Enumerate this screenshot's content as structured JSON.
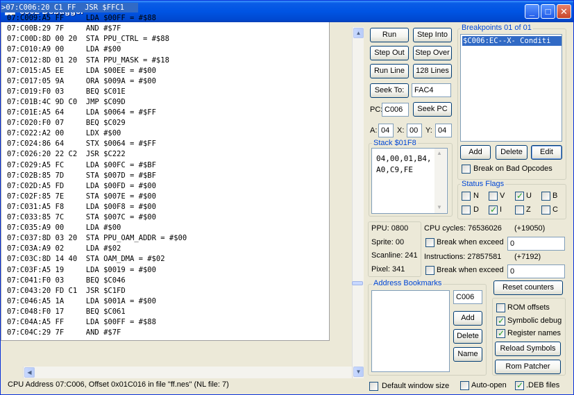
{
  "window": {
    "title": "6502 Debugger",
    "minimize": "_",
    "maximize": "□",
    "close": "✕"
  },
  "disassembly": {
    "lines": [
      ">07:C006:20 C1 FF  JSR $FFC1",
      "07:C009:A5 FF     LDA $00FF = #$88",
      "07:C00B:29 7F     AND #$7F",
      "07:C00D:8D 00 20  STA PPU_CTRL = #$88",
      "07:C010:A9 00     LDA #$00",
      "07:C012:8D 01 20  STA PPU_MASK = #$18",
      "07:C015:A5 EE     LDA $00EE = #$00",
      "07:C017:05 9A     ORA $009A = #$00",
      "07:C019:F0 03     BEQ $C01E",
      "07:C01B:4C 9D C0  JMP $C09D",
      "07:C01E:A5 64     LDA $0064 = #$FF",
      "07:C020:F0 07     BEQ $C029",
      "07:C022:A2 00     LDX #$00",
      "07:C024:86 64     STX $0064 = #$FF",
      "07:C026:20 22 C2  JSR $C222",
      "07:C029:A5 FC     LDA $00FC = #$BF",
      "07:C02B:85 7D     STA $007D = #$BF",
      "07:C02D:A5 FD     LDA $00FD = #$00",
      "07:C02F:85 7E     STA $007E = #$00",
      "07:C031:A5 F8     LDA $00F8 = #$00",
      "07:C033:85 7C     STA $007C = #$00",
      "07:C035:A9 00     LDA #$00",
      "07:C037:8D 03 20  STA PPU_OAM_ADDR = #$00",
      "07:C03A:A9 02     LDA #$02",
      "07:C03C:8D 14 40  STA OAM_DMA = #$02",
      "07:C03F:A5 19     LDA $0019 = #$00",
      "07:C041:F0 03     BEQ $C046",
      "07:C043:20 FD C1  JSR $C1FD",
      "07:C046:A5 1A     LDA $001A = #$00",
      "07:C048:F0 17     BEQ $C061",
      "07:C04A:A5 FF     LDA $00FF = #$88",
      "07:C04C:29 7F     AND #$7F"
    ]
  },
  "buttons": {
    "run": "Run",
    "step_into": "Step Into",
    "step_out": "Step Out",
    "step_over": "Step Over",
    "run_line": "Run Line",
    "lines_128": "128 Lines",
    "seek_to": "Seek To:",
    "seek_pc": "Seek PC",
    "add": "Add",
    "delete": "Delete",
    "edit": "Edit",
    "reset_counters": "Reset counters",
    "bm_add": "Add",
    "bm_delete": "Delete",
    "bm_name": "Name",
    "reload_symbols": "Reload Symbols",
    "rom_patcher": "Rom Patcher"
  },
  "seek_value": "FAC4",
  "pc": {
    "label": "PC:",
    "value": "C006"
  },
  "registers": {
    "a_label": "A:",
    "a": "04",
    "x_label": "X:",
    "x": "00",
    "y_label": "Y:",
    "y": "04"
  },
  "stack": {
    "title": "Stack $01F8",
    "line1": "04,00,01,B4,",
    "line2": "A0,C9,FE"
  },
  "breakpoints": {
    "title": "Breakpoints 01 of 01",
    "item": "$C006:EC--X- Conditi",
    "break_bad_opcodes": "Break on Bad Opcodes"
  },
  "flags": {
    "title": "Status Flags",
    "N": "N",
    "V": "V",
    "U": "U",
    "B": "B",
    "D": "D",
    "I": "I",
    "Z": "Z",
    "C": "C"
  },
  "ppu": {
    "ppu": "PPU: 0800",
    "sprite": "Sprite: 00",
    "scanline": "Scanline: 241",
    "pixel": "Pixel:  341"
  },
  "counters": {
    "cpu_cycles": "CPU cycles: 76536026",
    "cpu_delta": "(+19050)",
    "break_exceed_1": "Break when exceed",
    "exceed_1_value": "0",
    "instructions": "Instructions: 27857581",
    "instr_delta": "(+7192)",
    "break_exceed_2": "Break when exceed",
    "exceed_2_value": "0"
  },
  "bookmarks": {
    "title": "Address Bookmarks",
    "address": "C006"
  },
  "options": {
    "rom_offsets": "ROM offsets",
    "symbolic_debug": "Symbolic debug",
    "register_names": "Register names"
  },
  "bottom": {
    "default_window_size": "Default window size",
    "auto_open": "Auto-open",
    "deb_files": ".DEB files"
  },
  "status": "CPU Address 07:C006, Offset 0x01C016 in file \"ff.nes\" (NL file: 7)"
}
